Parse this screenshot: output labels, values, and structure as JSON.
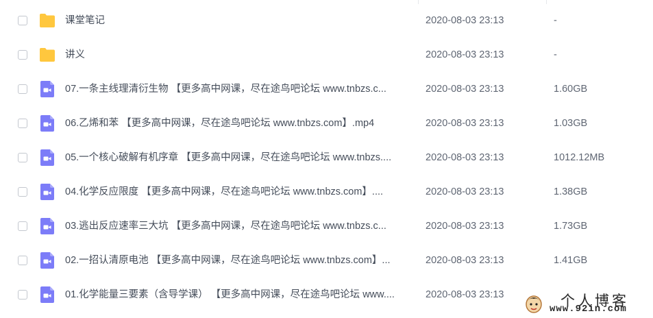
{
  "colors": {
    "folder": "#FFC73E",
    "video": "#7C7CF8",
    "divider": "#e6e8eb"
  },
  "files": [
    {
      "type": "folder",
      "icon": "folder-icon",
      "name": "课堂笔记",
      "time": "2020-08-03 23:13",
      "size": "-"
    },
    {
      "type": "folder",
      "icon": "folder-icon",
      "name": "讲义",
      "time": "2020-08-03 23:13",
      "size": "-"
    },
    {
      "type": "video",
      "icon": "video-file-icon",
      "name": "07.一条主线理清衍生物 【更多高中网课，尽在途鸟吧论坛 www.tnbzs.c...",
      "time": "2020-08-03 23:13",
      "size": "1.60GB"
    },
    {
      "type": "video",
      "icon": "video-file-icon",
      "name": "06.乙烯和苯 【更多高中网课，尽在途鸟吧论坛 www.tnbzs.com】.mp4",
      "time": "2020-08-03 23:13",
      "size": "1.03GB"
    },
    {
      "type": "video",
      "icon": "video-file-icon",
      "name": "05.一个核心破解有机序章 【更多高中网课，尽在途鸟吧论坛 www.tnbzs....",
      "time": "2020-08-03 23:13",
      "size": "1012.12MB"
    },
    {
      "type": "video",
      "icon": "video-file-icon",
      "name": "04.化学反应限度 【更多高中网课，尽在途鸟吧论坛 www.tnbzs.com】....",
      "time": "2020-08-03 23:13",
      "size": "1.38GB"
    },
    {
      "type": "video",
      "icon": "video-file-icon",
      "name": "03.逃出反应速率三大坑 【更多高中网课，尽在途鸟吧论坛 www.tnbzs.c...",
      "time": "2020-08-03 23:13",
      "size": "1.73GB"
    },
    {
      "type": "video",
      "icon": "video-file-icon",
      "name": "02.一招认清原电池 【更多高中网课，尽在途鸟吧论坛 www.tnbzs.com】...",
      "time": "2020-08-03 23:13",
      "size": "1.41GB"
    },
    {
      "type": "video",
      "icon": "video-file-icon",
      "name": "01.化学能量三要素（含导学课） 【更多高中网课，尽在途鸟吧论坛 www....",
      "time": "2020-08-03 23:13",
      "size": ""
    }
  ],
  "watermark": {
    "title": "个人博客",
    "url": "www.92in.com"
  }
}
